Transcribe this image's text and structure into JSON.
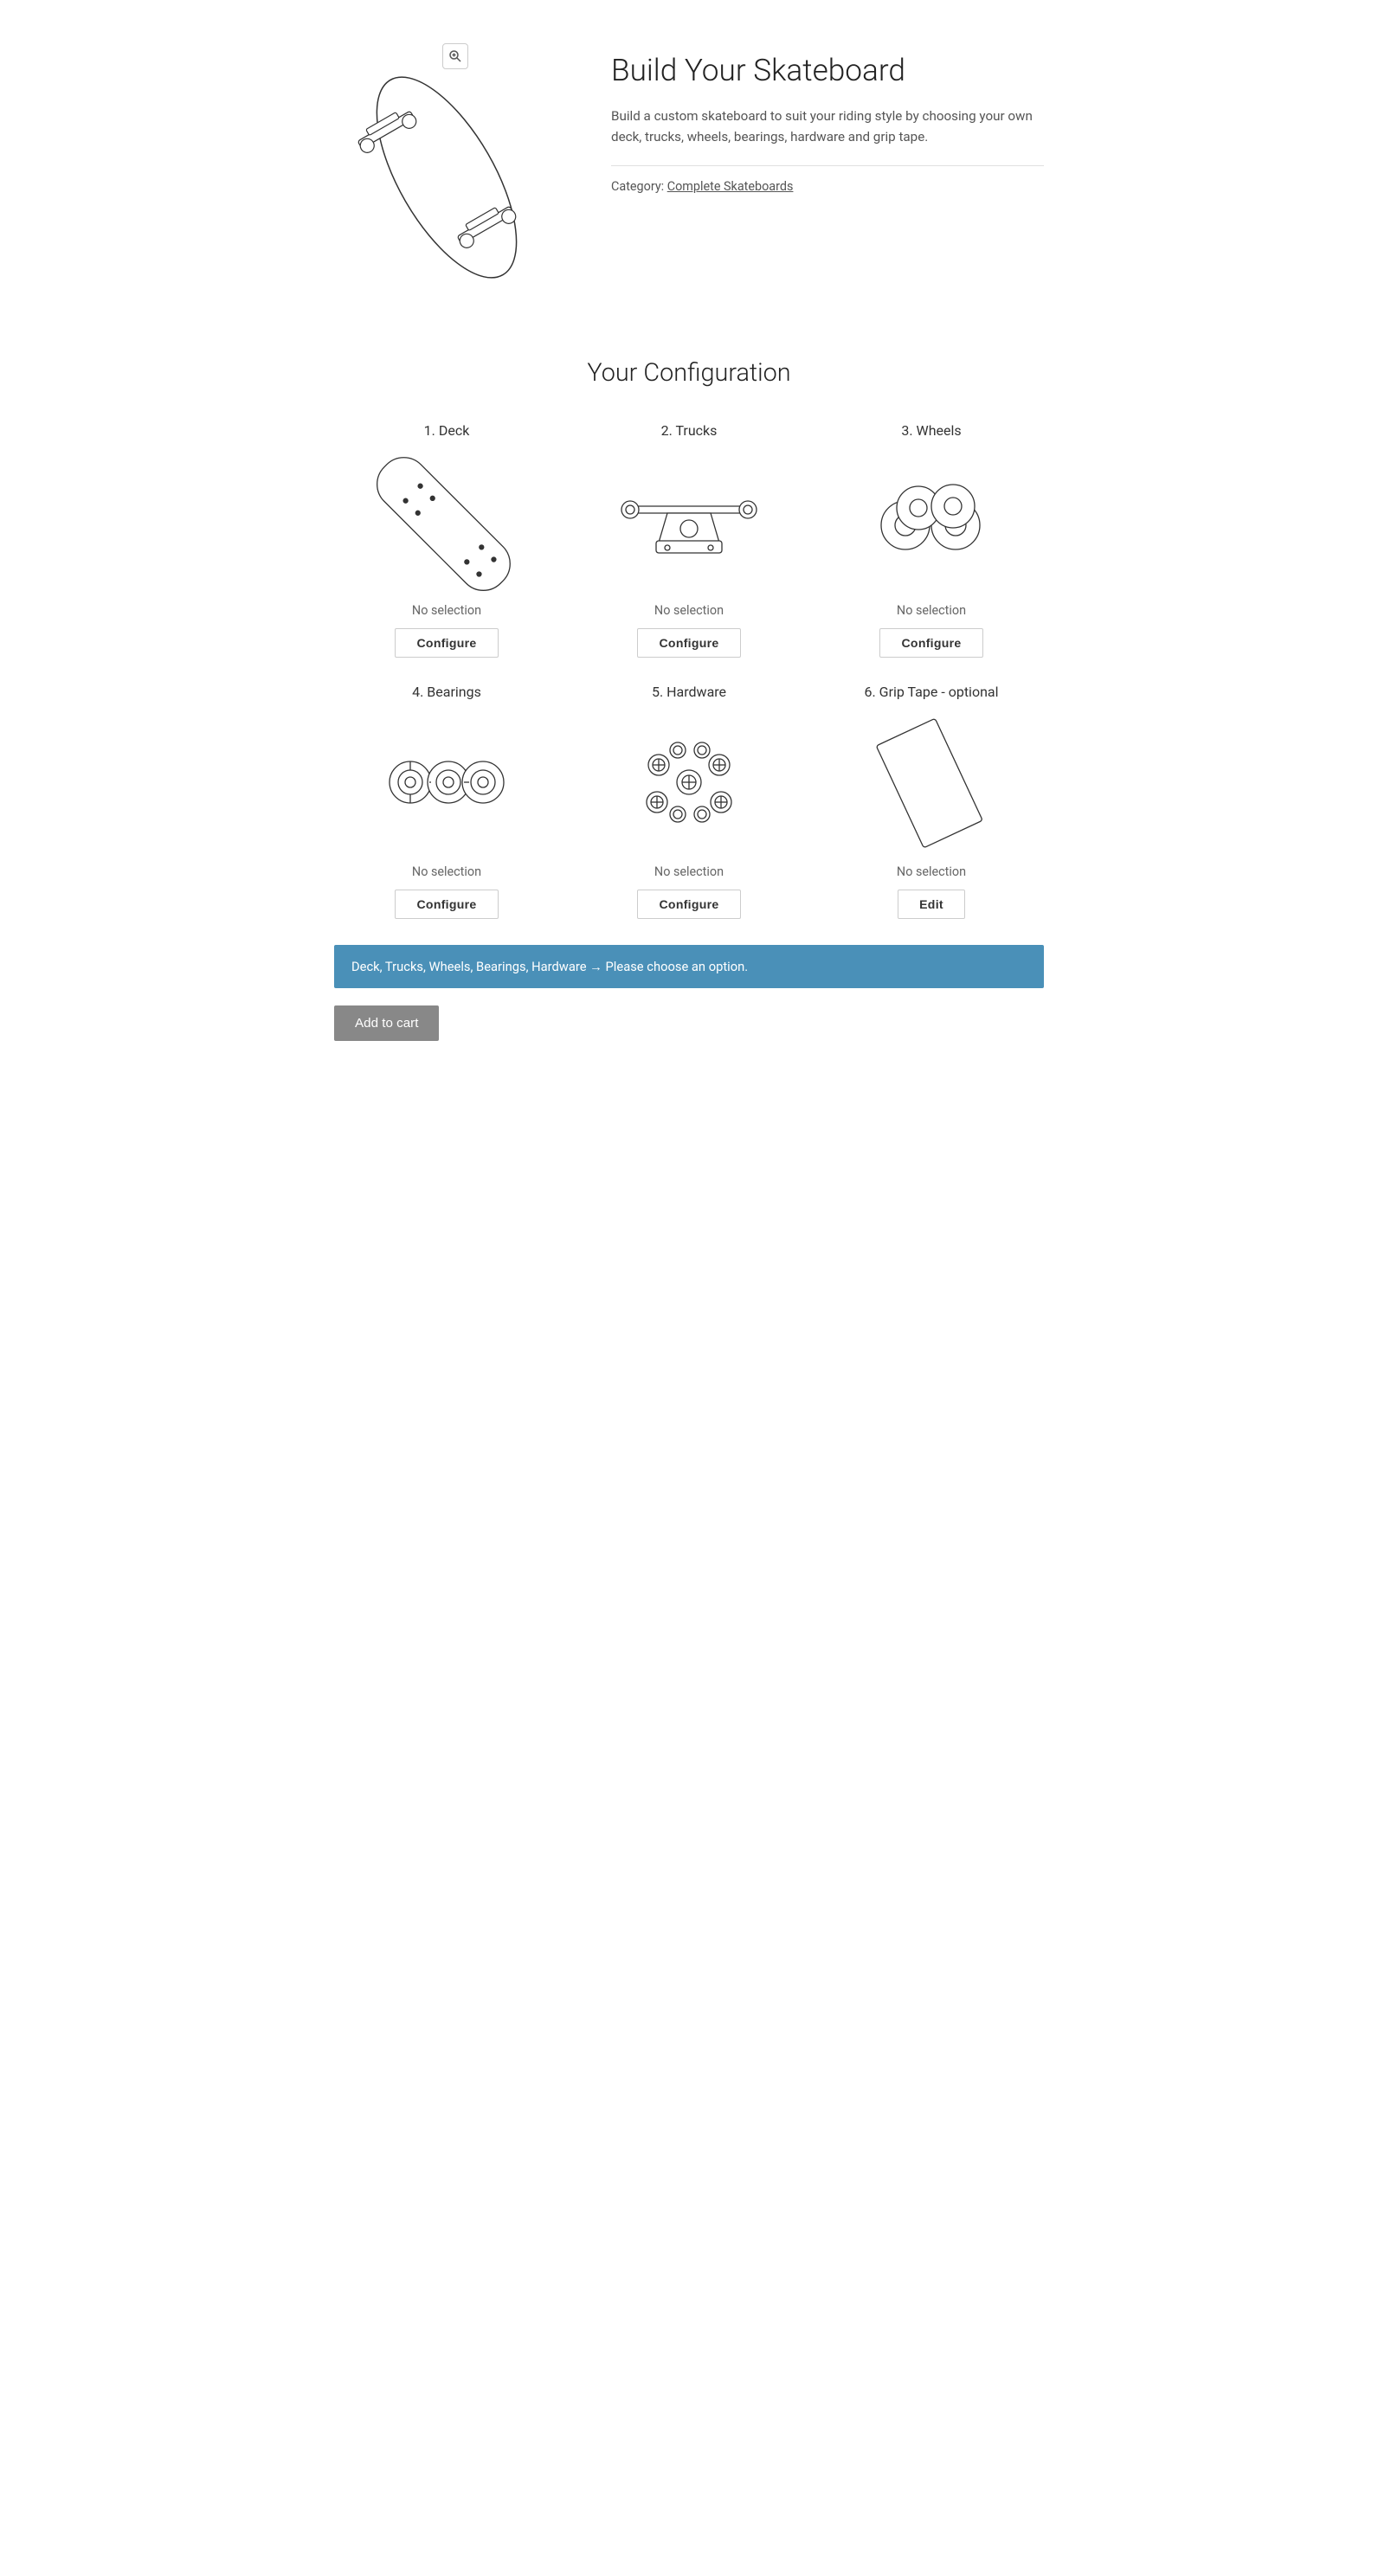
{
  "header": {
    "title": "Build Your Skateboard",
    "description": "Build a custom skateboard to suit your riding style by choosing your own deck, trucks, wheels, bearings, hardware and grip tape.",
    "category_label": "Category:",
    "category_link_text": "Complete Skateboards",
    "zoom_icon": "zoom-icon"
  },
  "config_section": {
    "title": "Your Configuration",
    "items": [
      {
        "id": "deck",
        "label": "1. Deck",
        "selection": "No selection",
        "button": "Configure",
        "button_type": "configure"
      },
      {
        "id": "trucks",
        "label": "2. Trucks",
        "selection": "No selection",
        "button": "Configure",
        "button_type": "configure"
      },
      {
        "id": "wheels",
        "label": "3. Wheels",
        "selection": "No selection",
        "button": "Configure",
        "button_type": "configure"
      },
      {
        "id": "bearings",
        "label": "4. Bearings",
        "selection": "No selection",
        "button": "Configure",
        "button_type": "configure"
      },
      {
        "id": "hardware",
        "label": "5. Hardware",
        "selection": "No selection",
        "button": "Configure",
        "button_type": "configure"
      },
      {
        "id": "grip-tape",
        "label": "6. Grip Tape - optional",
        "selection": "No selection",
        "button": "Edit",
        "button_type": "edit"
      }
    ]
  },
  "notice": {
    "text": "Deck, Trucks, Wheels, Bearings, Hardware → Please choose an option."
  },
  "add_to_cart": {
    "label": "Add to cart"
  }
}
